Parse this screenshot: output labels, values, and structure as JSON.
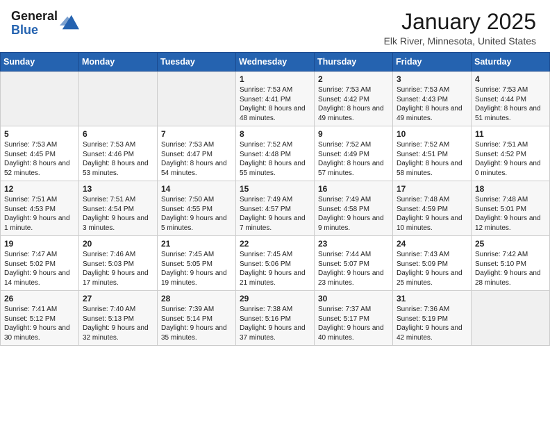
{
  "logo": {
    "general": "General",
    "blue": "Blue"
  },
  "header": {
    "month": "January 2025",
    "location": "Elk River, Minnesota, United States"
  },
  "days_of_week": [
    "Sunday",
    "Monday",
    "Tuesday",
    "Wednesday",
    "Thursday",
    "Friday",
    "Saturday"
  ],
  "weeks": [
    [
      {
        "day": "",
        "info": ""
      },
      {
        "day": "",
        "info": ""
      },
      {
        "day": "",
        "info": ""
      },
      {
        "day": "1",
        "info": "Sunrise: 7:53 AM\nSunset: 4:41 PM\nDaylight: 8 hours and 48 minutes."
      },
      {
        "day": "2",
        "info": "Sunrise: 7:53 AM\nSunset: 4:42 PM\nDaylight: 8 hours and 49 minutes."
      },
      {
        "day": "3",
        "info": "Sunrise: 7:53 AM\nSunset: 4:43 PM\nDaylight: 8 hours and 49 minutes."
      },
      {
        "day": "4",
        "info": "Sunrise: 7:53 AM\nSunset: 4:44 PM\nDaylight: 8 hours and 51 minutes."
      }
    ],
    [
      {
        "day": "5",
        "info": "Sunrise: 7:53 AM\nSunset: 4:45 PM\nDaylight: 8 hours and 52 minutes."
      },
      {
        "day": "6",
        "info": "Sunrise: 7:53 AM\nSunset: 4:46 PM\nDaylight: 8 hours and 53 minutes."
      },
      {
        "day": "7",
        "info": "Sunrise: 7:53 AM\nSunset: 4:47 PM\nDaylight: 8 hours and 54 minutes."
      },
      {
        "day": "8",
        "info": "Sunrise: 7:52 AM\nSunset: 4:48 PM\nDaylight: 8 hours and 55 minutes."
      },
      {
        "day": "9",
        "info": "Sunrise: 7:52 AM\nSunset: 4:49 PM\nDaylight: 8 hours and 57 minutes."
      },
      {
        "day": "10",
        "info": "Sunrise: 7:52 AM\nSunset: 4:51 PM\nDaylight: 8 hours and 58 minutes."
      },
      {
        "day": "11",
        "info": "Sunrise: 7:51 AM\nSunset: 4:52 PM\nDaylight: 9 hours and 0 minutes."
      }
    ],
    [
      {
        "day": "12",
        "info": "Sunrise: 7:51 AM\nSunset: 4:53 PM\nDaylight: 9 hours and 1 minute."
      },
      {
        "day": "13",
        "info": "Sunrise: 7:51 AM\nSunset: 4:54 PM\nDaylight: 9 hours and 3 minutes."
      },
      {
        "day": "14",
        "info": "Sunrise: 7:50 AM\nSunset: 4:55 PM\nDaylight: 9 hours and 5 minutes."
      },
      {
        "day": "15",
        "info": "Sunrise: 7:49 AM\nSunset: 4:57 PM\nDaylight: 9 hours and 7 minutes."
      },
      {
        "day": "16",
        "info": "Sunrise: 7:49 AM\nSunset: 4:58 PM\nDaylight: 9 hours and 9 minutes."
      },
      {
        "day": "17",
        "info": "Sunrise: 7:48 AM\nSunset: 4:59 PM\nDaylight: 9 hours and 10 minutes."
      },
      {
        "day": "18",
        "info": "Sunrise: 7:48 AM\nSunset: 5:01 PM\nDaylight: 9 hours and 12 minutes."
      }
    ],
    [
      {
        "day": "19",
        "info": "Sunrise: 7:47 AM\nSunset: 5:02 PM\nDaylight: 9 hours and 14 minutes."
      },
      {
        "day": "20",
        "info": "Sunrise: 7:46 AM\nSunset: 5:03 PM\nDaylight: 9 hours and 17 minutes."
      },
      {
        "day": "21",
        "info": "Sunrise: 7:45 AM\nSunset: 5:05 PM\nDaylight: 9 hours and 19 minutes."
      },
      {
        "day": "22",
        "info": "Sunrise: 7:45 AM\nSunset: 5:06 PM\nDaylight: 9 hours and 21 minutes."
      },
      {
        "day": "23",
        "info": "Sunrise: 7:44 AM\nSunset: 5:07 PM\nDaylight: 9 hours and 23 minutes."
      },
      {
        "day": "24",
        "info": "Sunrise: 7:43 AM\nSunset: 5:09 PM\nDaylight: 9 hours and 25 minutes."
      },
      {
        "day": "25",
        "info": "Sunrise: 7:42 AM\nSunset: 5:10 PM\nDaylight: 9 hours and 28 minutes."
      }
    ],
    [
      {
        "day": "26",
        "info": "Sunrise: 7:41 AM\nSunset: 5:12 PM\nDaylight: 9 hours and 30 minutes."
      },
      {
        "day": "27",
        "info": "Sunrise: 7:40 AM\nSunset: 5:13 PM\nDaylight: 9 hours and 32 minutes."
      },
      {
        "day": "28",
        "info": "Sunrise: 7:39 AM\nSunset: 5:14 PM\nDaylight: 9 hours and 35 minutes."
      },
      {
        "day": "29",
        "info": "Sunrise: 7:38 AM\nSunset: 5:16 PM\nDaylight: 9 hours and 37 minutes."
      },
      {
        "day": "30",
        "info": "Sunrise: 7:37 AM\nSunset: 5:17 PM\nDaylight: 9 hours and 40 minutes."
      },
      {
        "day": "31",
        "info": "Sunrise: 7:36 AM\nSunset: 5:19 PM\nDaylight: 9 hours and 42 minutes."
      },
      {
        "day": "",
        "info": ""
      }
    ]
  ]
}
